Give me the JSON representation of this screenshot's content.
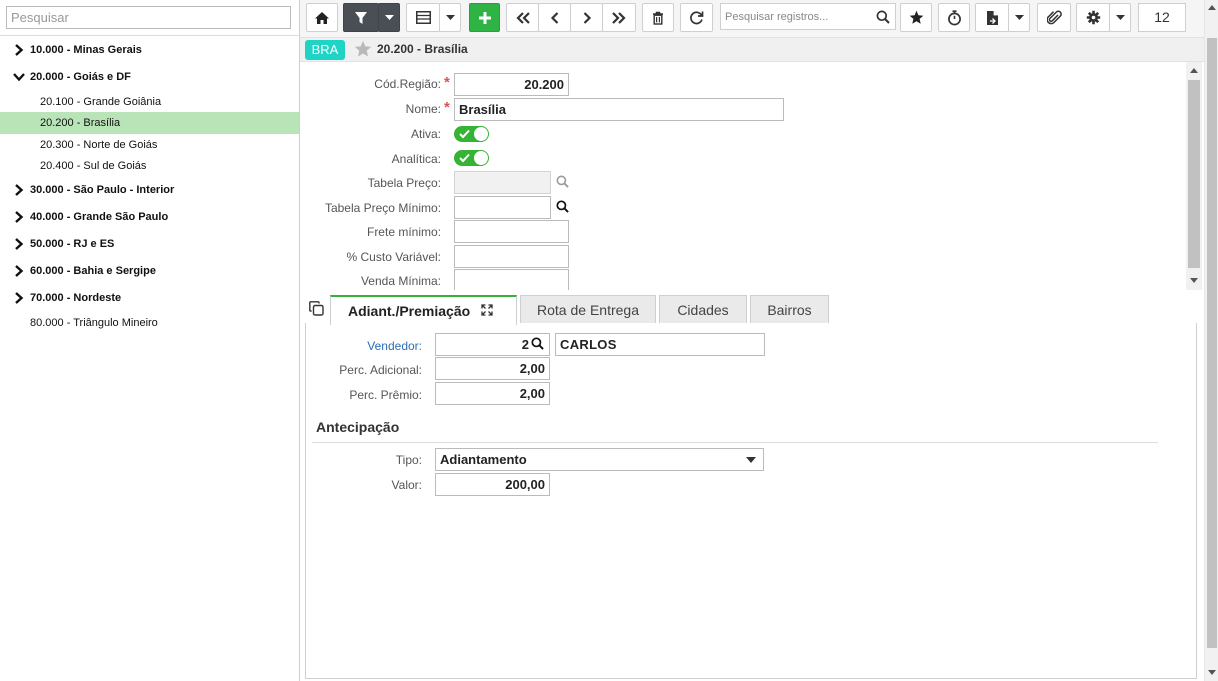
{
  "left": {
    "search_placeholder": "Pesquisar",
    "tree": [
      {
        "label": "10.000 - Minas Gerais",
        "state": "collapsed"
      },
      {
        "label": "20.000 - Goiás e DF",
        "state": "expanded"
      },
      {
        "label": "20.100 - Grande Goiânia",
        "state": "leaf"
      },
      {
        "label": "20.200 - Brasília",
        "state": "leaf",
        "selected": true
      },
      {
        "label": "20.300 - Norte de Goiás",
        "state": "leaf"
      },
      {
        "label": "20.400 - Sul de Goiás",
        "state": "leaf"
      },
      {
        "label": "30.000 - São Paulo - Interior",
        "state": "collapsed"
      },
      {
        "label": "40.000 - Grande São Paulo",
        "state": "collapsed"
      },
      {
        "label": "50.000 - RJ e ES",
        "state": "collapsed"
      },
      {
        "label": "60.000 - Bahia e Sergipe",
        "state": "collapsed"
      },
      {
        "label": "70.000 - Nordeste",
        "state": "collapsed"
      },
      {
        "label": "80.000 - Triângulo Mineiro",
        "state": "leaf"
      }
    ]
  },
  "toolbar": {
    "search_placeholder": "Pesquisar registros...",
    "record_count": "12",
    "icons": [
      "home-icon",
      "filter-icon",
      "grid-icon",
      "plus-icon",
      "first-icon",
      "prev-icon",
      "next-icon",
      "last-icon",
      "trash-icon",
      "refresh-icon",
      "search-icon",
      "star-icon",
      "stopwatch-icon",
      "report-icon",
      "paperclip-icon",
      "gear-icon"
    ]
  },
  "record": {
    "badge": "BRA",
    "title": "20.200 - Brasília"
  },
  "form": {
    "cod_regiao": {
      "label": "Cód.Região:",
      "value": "20.200"
    },
    "nome": {
      "label": "Nome:",
      "value": "Brasília"
    },
    "ativa": {
      "label": "Ativa:",
      "on": true
    },
    "analitica": {
      "label": "Analítica:",
      "on": true
    },
    "tabela_preco": {
      "label": "Tabela Preço:",
      "value": ""
    },
    "tabela_preco_minimo": {
      "label": "Tabela Preço Mínimo:",
      "value": ""
    },
    "frete_minimo": {
      "label": "Frete mínimo:",
      "value": ""
    },
    "custo_variavel": {
      "label": "% Custo Variável:",
      "value": ""
    },
    "venda_minima": {
      "label": "Venda Mínima:",
      "value": ""
    }
  },
  "tabs": [
    {
      "label": "Adiant./Premiação",
      "active": true
    },
    {
      "label": "Rota de Entrega",
      "active": false
    },
    {
      "label": "Cidades",
      "active": false
    },
    {
      "label": "Bairros",
      "active": false
    }
  ],
  "panel": {
    "vendedor": {
      "label": "Vendedor:",
      "code": "2",
      "name": "CARLOS"
    },
    "perc_adicional": {
      "label": "Perc. Adicional:",
      "value": "2,00"
    },
    "perc_premio": {
      "label": "Perc. Prêmio:",
      "value": "2,00"
    },
    "antecipacao_title": "Antecipação",
    "tipo": {
      "label": "Tipo:",
      "value": "Adiantamento"
    },
    "valor": {
      "label": "Valor:",
      "value": "200,00"
    }
  },
  "colors": {
    "accent_green": "#2fb344",
    "selected_row": "#b8e4b8",
    "badge": "#1fd4c5",
    "toolbar_dark": "#4a4f55",
    "required": "#d9534f",
    "link": "#2a6ebb"
  }
}
